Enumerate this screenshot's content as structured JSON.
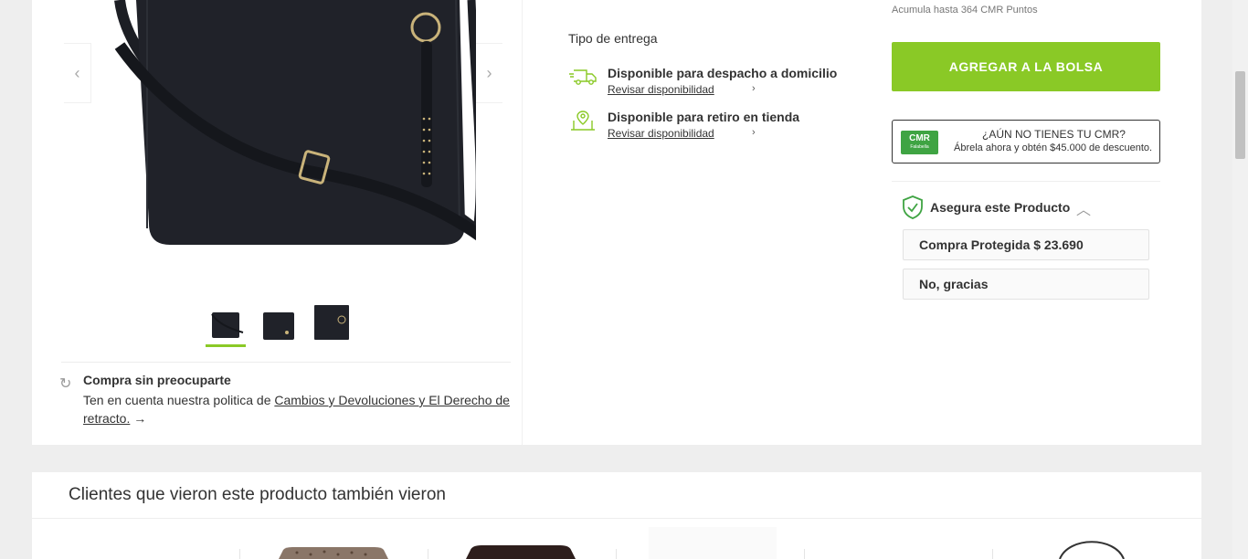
{
  "gallery": {
    "prev_arrow": "‹",
    "next_arrow": "›",
    "thumbnails": [
      "thumb-1",
      "thumb-2",
      "thumb-3"
    ]
  },
  "worry": {
    "icon": "refresh-icon",
    "title": "Compra sin preocuparte",
    "text_prefix": "Ten en cuenta nuestra politica de ",
    "link": "Cambios y Devoluciones y El Derecho de retracto.",
    "arrow": "→"
  },
  "delivery": {
    "title": "Tipo de entrega",
    "options": [
      {
        "icon": "truck-icon",
        "label": "Disponible para despacho a domicilio",
        "link": "Revisar disponibilidad",
        "chevron": "›"
      },
      {
        "icon": "store-pin-icon",
        "label": "Disponible para retiro en tienda",
        "link": "Revisar disponibilidad",
        "chevron": "›"
      }
    ]
  },
  "purchase": {
    "points": "Acumula hasta 364 CMR Puntos",
    "add_button": "AGREGAR A LA BOLSA",
    "accent_color": "#8ac926",
    "cmr": {
      "logo_text": "CMR",
      "logo_sub": "Falabella",
      "question": "¿AÚN NO TIENES TU CMR?",
      "offer": "Ábrela ahora y obtén $45.000 de descuento."
    },
    "insurance": {
      "icon": "shield-check-icon",
      "title": "Asegura este Producto",
      "chevron": "︿",
      "options": [
        "Compra Protegida $ 23.690",
        "No, gracias"
      ]
    }
  },
  "related": {
    "title": "Clientes que vieron este producto también vieron"
  }
}
